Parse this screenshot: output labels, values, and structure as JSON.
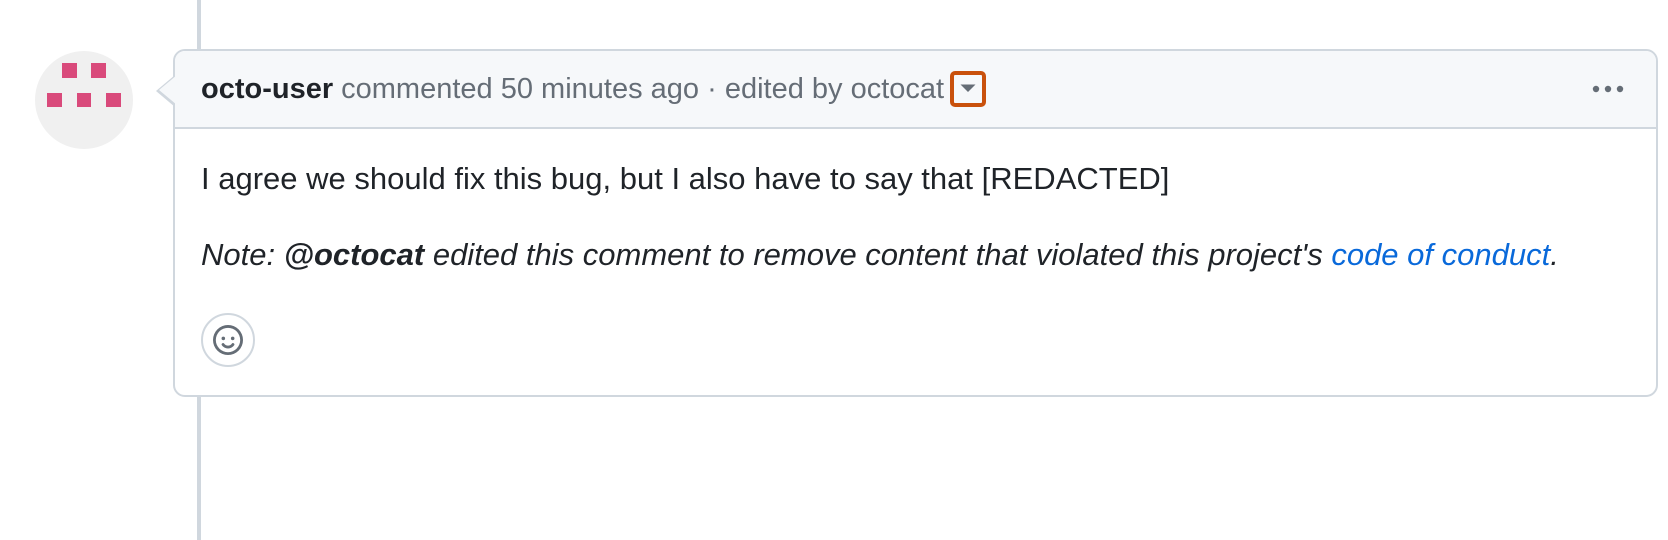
{
  "comment": {
    "author": "octo-user",
    "action_label": "commented",
    "timestamp": "50 minutes ago",
    "separator": "·",
    "edited_prefix": "edited by",
    "edited_by": "octocat",
    "body_text": "I agree we should fix this bug, but I also have to say that [REDACTED]",
    "note_prefix": "Note:",
    "note_mention": "@octocat",
    "note_rest": "edited this comment to remove content that violated this project's",
    "note_link_text": "code of conduct",
    "note_suffix": "."
  },
  "icons": {
    "edit_history_caret": "chevron-down",
    "overflow": "kebab",
    "react": "smiley"
  }
}
